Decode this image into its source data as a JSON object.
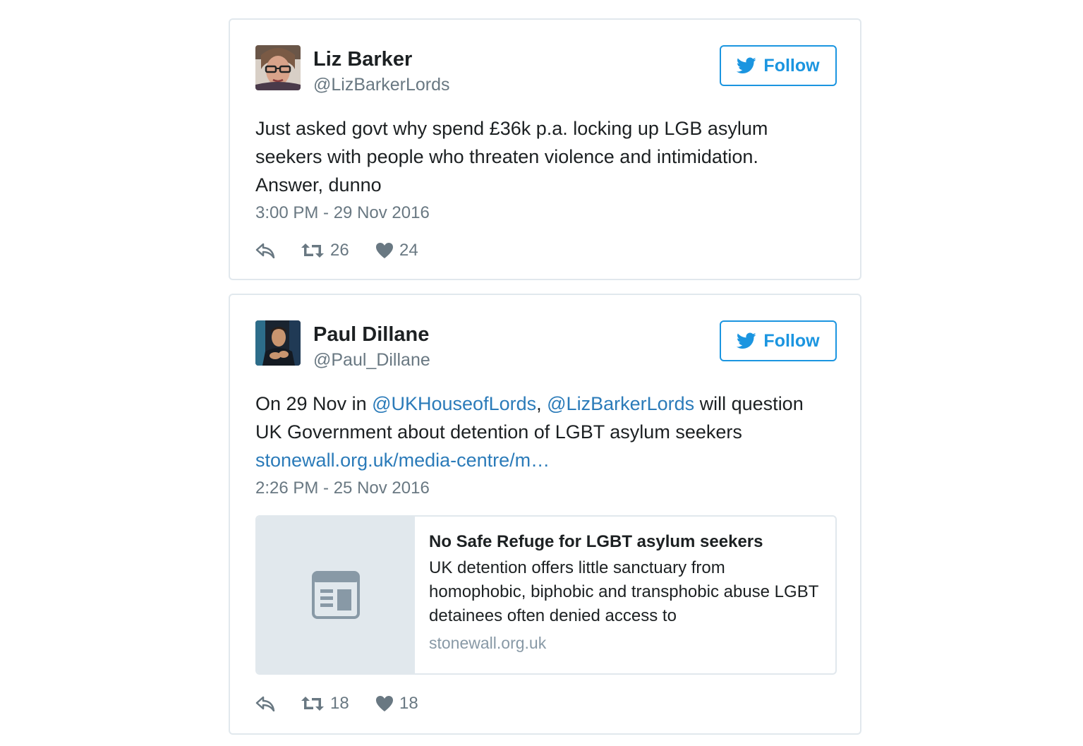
{
  "tweets": [
    {
      "author": {
        "name": "Liz Barker",
        "handle": "@LizBarkerLords"
      },
      "follow_label": "Follow",
      "text": "Just asked govt why spend £36k p.a. locking up LGB asylum seekers with people who threaten violence and intimidation. Answer, dunno",
      "timestamp": "3:00 PM - 29 Nov 2016",
      "retweets": "26",
      "likes": "24"
    },
    {
      "author": {
        "name": "Paul Dillane",
        "handle": "@Paul_Dillane"
      },
      "follow_label": "Follow",
      "text_parts": {
        "t1": "On 29 Nov in ",
        "mention1": "@UKHouseofLords",
        "t2": ", ",
        "mention2": "@LizBarkerLords",
        "t3": " will question UK Government about detention of LGBT asylum seekers ",
        "link": "stonewall.org.uk/media-centre/m…"
      },
      "timestamp": "2:26 PM - 25 Nov 2016",
      "card": {
        "title": "No Safe Refuge for LGBT asylum seekers",
        "description": "UK detention offers little sanctuary from homophobic, biphobic and transphobic abuse LGBT detainees often denied access to",
        "domain": "stonewall.org.uk"
      },
      "retweets": "18",
      "likes": "18"
    }
  ],
  "colors": {
    "twitter_blue": "#1b95e0",
    "link_blue": "#2b7bb9",
    "muted_gray": "#697882",
    "border_gray": "#e1e8ed"
  },
  "icons": {
    "follow": "twitter-bird-icon",
    "reply": "reply-icon",
    "retweet": "retweet-icon",
    "like": "heart-icon",
    "card_placeholder": "article-icon"
  }
}
